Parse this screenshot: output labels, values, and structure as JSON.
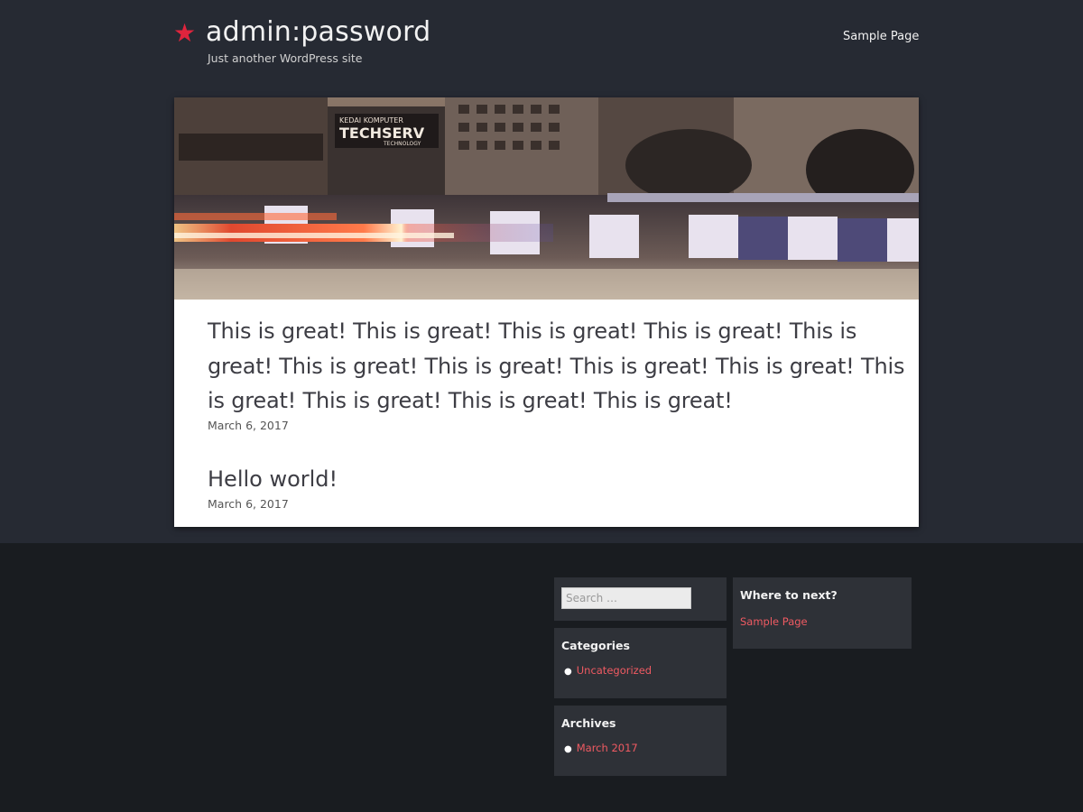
{
  "header": {
    "site_title": "admin:password",
    "tagline": "Just another WordPress site",
    "nav": [
      "Sample Page"
    ]
  },
  "hero": {
    "sign_1": "KEDAI KOMPUTER",
    "sign_2": "TECHSERV",
    "sign_3": "TECHNOLOGY"
  },
  "posts": [
    {
      "title": "This is great! This is great! This is great! This is great! This is great! This is great! This is great! This is great! This is great! This is great! This is great! This is great! This is great!",
      "date": "March 6, 2017"
    },
    {
      "title": "Hello world!",
      "date": "March 6, 2017"
    }
  ],
  "sidebar": {
    "search_placeholder": "Search …",
    "categories_title": "Categories",
    "categories": [
      "Uncategorized"
    ],
    "archives_title": "Archives",
    "archives": [
      "March 2017"
    ],
    "next_title": "Where to next?",
    "next_links": [
      "Sample Page"
    ]
  },
  "colors": {
    "accent": "#e0243d",
    "link": "#ef5a62",
    "header_bg": "#262a33",
    "footer_bg": "#191c20",
    "widget_bg": "#2e3137"
  }
}
